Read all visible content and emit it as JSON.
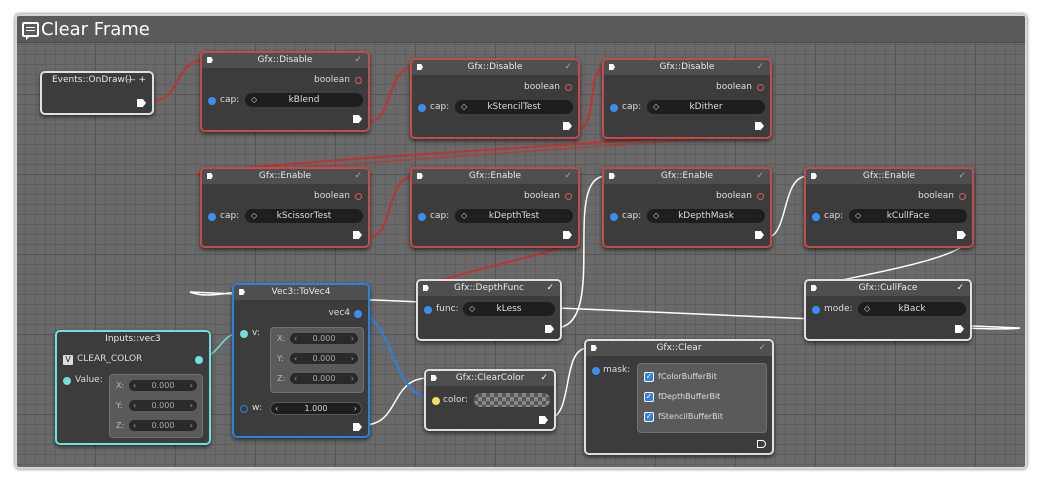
{
  "title": "Clear Frame",
  "nodes": {
    "ondraw": {
      "title": "Events::OnDraw()",
      "controls": "— +"
    },
    "disable1": {
      "title": "Gfx::Disable",
      "out": "boolean",
      "in_label": "cap:",
      "value": "kBlend"
    },
    "disable2": {
      "title": "Gfx::Disable",
      "out": "boolean",
      "in_label": "cap:",
      "value": "kStencilTest"
    },
    "disable3": {
      "title": "Gfx::Disable",
      "out": "boolean",
      "in_label": "cap:",
      "value": "kDither"
    },
    "enable1": {
      "title": "Gfx::Enable",
      "out": "boolean",
      "in_label": "cap:",
      "value": "kScissorTest"
    },
    "enable2": {
      "title": "Gfx::Enable",
      "out": "boolean",
      "in_label": "cap:",
      "value": "kDepthTest"
    },
    "enable3": {
      "title": "Gfx::Enable",
      "out": "boolean",
      "in_label": "cap:",
      "value": "kDepthMask"
    },
    "enable4": {
      "title": "Gfx::Enable",
      "out": "boolean",
      "in_label": "cap:",
      "value": "kCullFace"
    },
    "depthfunc": {
      "title": "Gfx::DepthFunc",
      "in_label": "func:",
      "value": "kLess"
    },
    "cullface": {
      "title": "Gfx::CullFace",
      "in_label": "mode:",
      "value": "kBack"
    },
    "inputs": {
      "title": "Inputs::vec3",
      "var_badge": "V",
      "var_name": "CLEAR_COLOR",
      "value_label": "Value:",
      "x": "0.000",
      "y": "0.000",
      "z": "0.000",
      "xl": "X:",
      "yl": "Y:",
      "zl": "Z:"
    },
    "tovec4": {
      "title": "Vec3::ToVec4",
      "out": "vec4",
      "v_label": "v:",
      "w_label": "w:",
      "x": "0.000",
      "y": "0.000",
      "z": "0.000",
      "w": "1.000",
      "xl": "X:",
      "yl": "Y:",
      "zl": "Z:"
    },
    "clearcolor": {
      "title": "Gfx::ClearColor",
      "in_label": "color:"
    },
    "clear": {
      "title": "Gfx::Clear",
      "in_label": "mask:",
      "bits": [
        "fColorBufferBit",
        "fDepthBufferBit",
        "fStencilBufferBit"
      ]
    }
  },
  "check_glyph": "✓",
  "colors": {
    "disable_border": "#c24c4c",
    "white_border": "#e0e0e0",
    "blue_border": "#2f7fe0",
    "teal_border": "#6ee0e0",
    "flow_wire": "#c23232",
    "data_wire": "#2f7fe0"
  }
}
